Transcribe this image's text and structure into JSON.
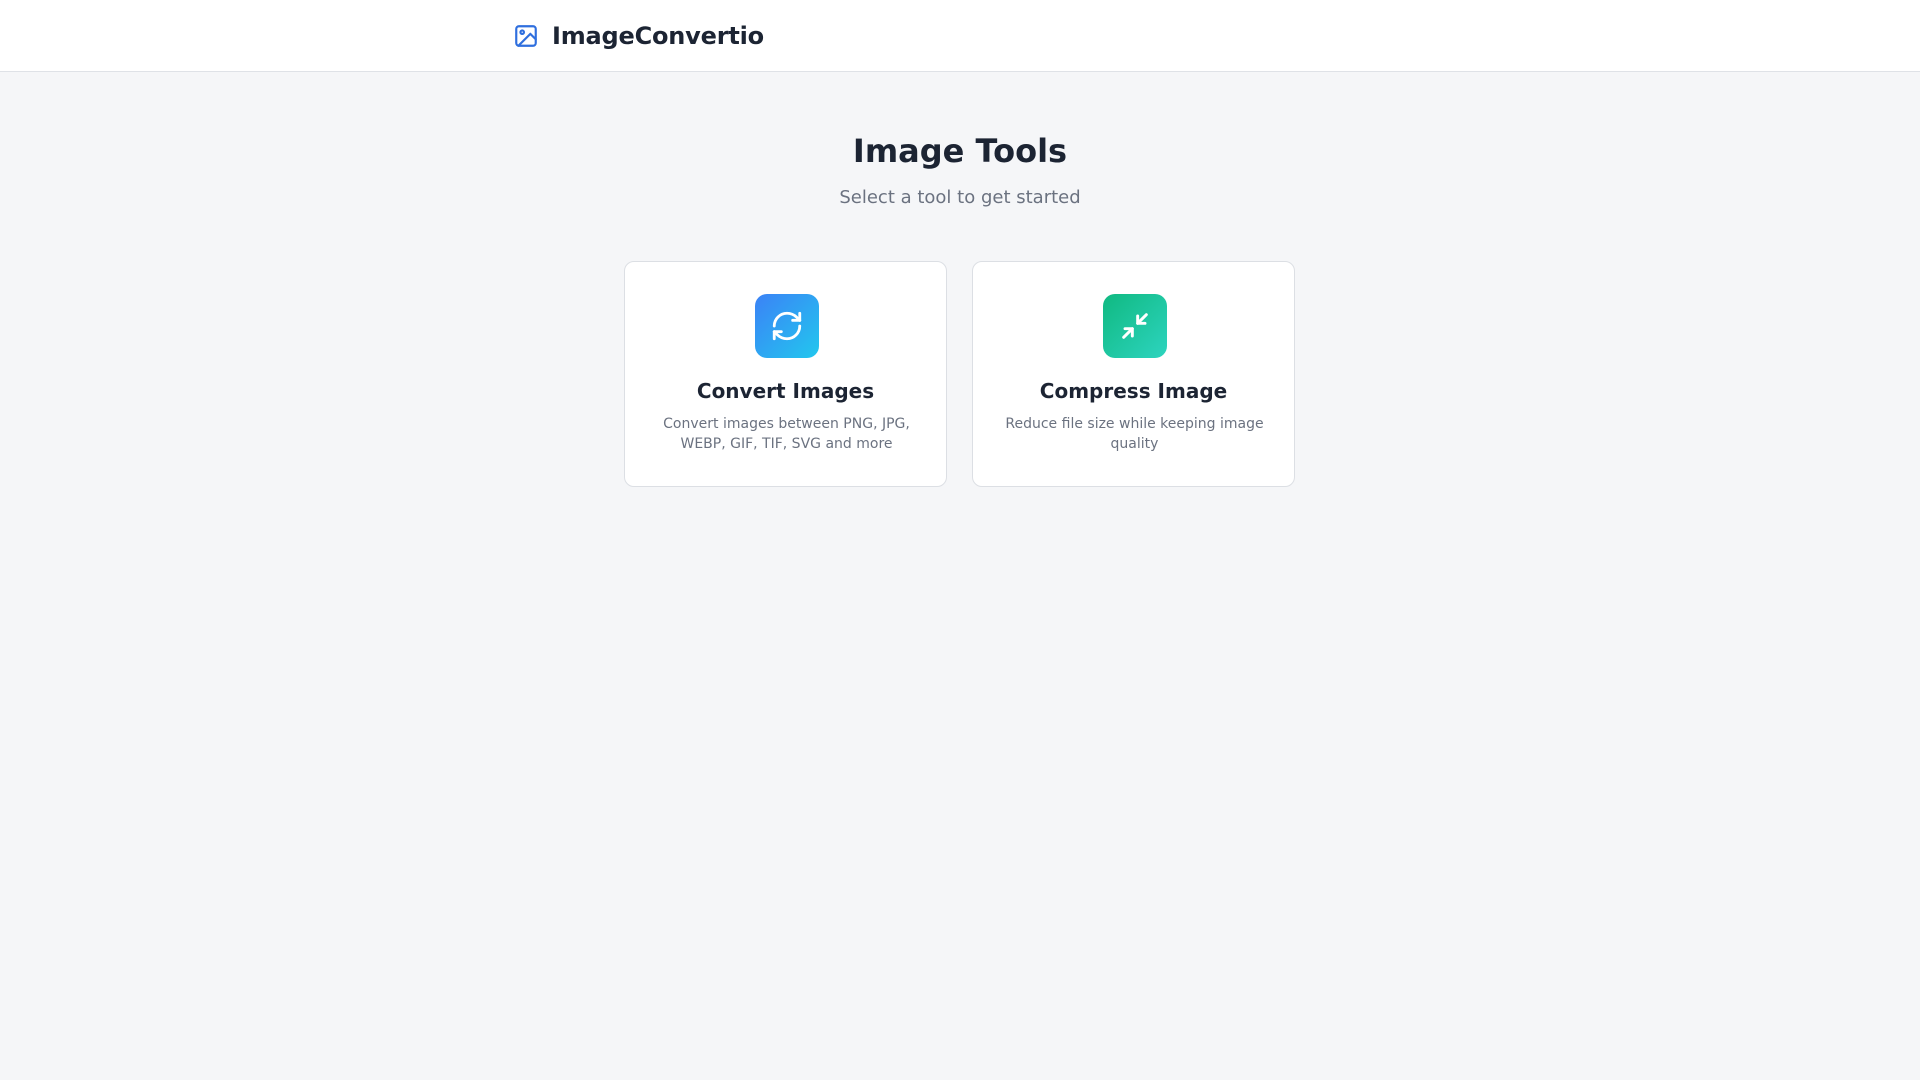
{
  "header": {
    "brand_name": "ImageConvertio",
    "brand_icon": "image-icon",
    "accent_color": "#2f6fde"
  },
  "main": {
    "title": "Image Tools",
    "subtitle": "Select a tool to get started"
  },
  "tools": [
    {
      "title": "Convert Images",
      "description": "Convert images between PNG, JPG, WEBP, GIF, TIF, SVG and more",
      "icon": "refresh-icon",
      "gradient": [
        "#3b82f6",
        "#22c7ee"
      ]
    },
    {
      "title": "Compress Image",
      "description": "Reduce file size while keeping image quality",
      "icon": "compress-icon",
      "gradient": [
        "#10b981",
        "#2dd4bf"
      ]
    }
  ]
}
